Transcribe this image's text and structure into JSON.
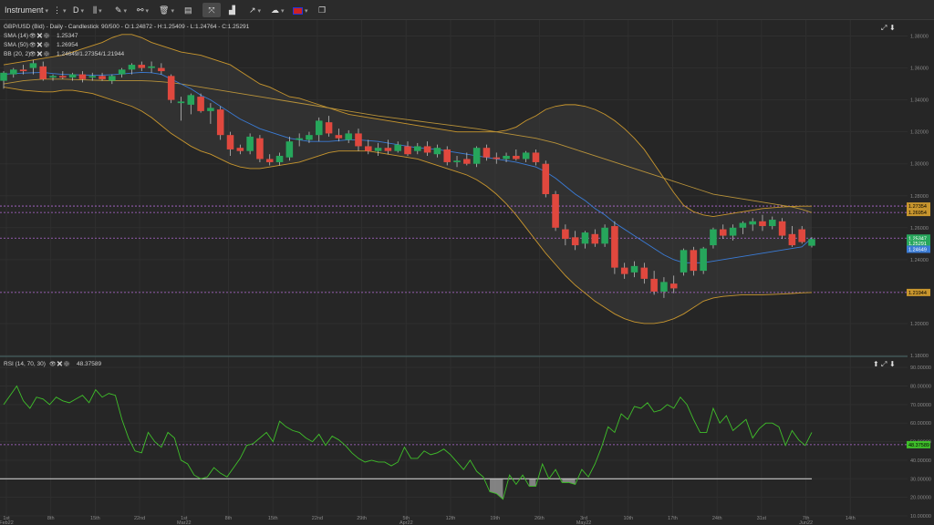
{
  "toolbar": {
    "instrument_label": "Instrument",
    "timeframe_label": "D",
    "language_flag": "gb-flag-icon"
  },
  "price_header": {
    "title": "GBP/USD (Bid) - Daily - Candlestick",
    "ohlc": "90/500 - O:1.24872 - H:1.25409 - L:1.24764 - C:1.25291",
    "sma14_label": "SMA (14)",
    "sma14_value": "1.25347",
    "sma50_label": "SMA (50)",
    "sma50_value": "1.26954",
    "bb_label": "BB (20, 2)",
    "bb_value": "1.24649/1.27354/1.21944"
  },
  "rsi_header": {
    "label": "RSI (14, 70, 30)",
    "value": "48.37589"
  },
  "price_axis": [
    "1.38000",
    "1.36000",
    "1.34000",
    "1.32000",
    "1.30000",
    "1.28000",
    "1.26000",
    "1.24000",
    "1.22000",
    "1.20000",
    "1.18000"
  ],
  "price_tags": {
    "bb_upper": "1.27354",
    "sma50": "1.26954",
    "sma14": "1.25347",
    "close": "1.25291",
    "bb_mid": "1.24649",
    "bb_lower": "1.21944"
  },
  "rsi_axis": [
    "90.00000",
    "80.00000",
    "70.00000",
    "60.00000",
    "50.00000",
    "40.00000",
    "30.00000",
    "20.00000",
    "10.00000"
  ],
  "rsi_tag": "48.37589",
  "date_axis": [
    {
      "label": "1st",
      "sub": "Feb22"
    },
    {
      "label": "8th",
      "sub": ""
    },
    {
      "label": "15th",
      "sub": ""
    },
    {
      "label": "22nd",
      "sub": ""
    },
    {
      "label": "1st",
      "sub": "Mar22"
    },
    {
      "label": "8th",
      "sub": ""
    },
    {
      "label": "15th",
      "sub": ""
    },
    {
      "label": "22nd",
      "sub": ""
    },
    {
      "label": "29th",
      "sub": ""
    },
    {
      "label": "5th",
      "sub": "Apr22"
    },
    {
      "label": "12th",
      "sub": ""
    },
    {
      "label": "19th",
      "sub": ""
    },
    {
      "label": "26th",
      "sub": ""
    },
    {
      "label": "3rd",
      "sub": "May22"
    },
    {
      "label": "10th",
      "sub": ""
    },
    {
      "label": "17th",
      "sub": ""
    },
    {
      "label": "24th",
      "sub": ""
    },
    {
      "label": "31st",
      "sub": ""
    },
    {
      "label": "7th",
      "sub": "Jun22"
    },
    {
      "label": "14th",
      "sub": ""
    }
  ],
  "colors": {
    "bull": "#26a65b",
    "bear": "#e0483e",
    "sma14": "#3a7bd5",
    "sma50": "#b8923a",
    "bb": "#c8962e",
    "rsi": "#3fbf2a",
    "hline": "#b36ad6"
  },
  "chart_data": {
    "type": "candlestick",
    "symbol": "GBP/USD (Bid)",
    "price_range": [
      1.18,
      1.39
    ],
    "candles": [
      {
        "o": 1.352,
        "h": 1.358,
        "l": 1.347,
        "c": 1.357
      },
      {
        "o": 1.356,
        "h": 1.36,
        "l": 1.354,
        "c": 1.359
      },
      {
        "o": 1.359,
        "h": 1.362,
        "l": 1.356,
        "c": 1.358
      },
      {
        "o": 1.36,
        "h": 1.365,
        "l": 1.356,
        "c": 1.363
      },
      {
        "o": 1.361,
        "h": 1.364,
        "l": 1.352,
        "c": 1.353
      },
      {
        "o": 1.354,
        "h": 1.356,
        "l": 1.352,
        "c": 1.355
      },
      {
        "o": 1.355,
        "h": 1.358,
        "l": 1.353,
        "c": 1.354
      },
      {
        "o": 1.354,
        "h": 1.357,
        "l": 1.352,
        "c": 1.356
      },
      {
        "o": 1.356,
        "h": 1.358,
        "l": 1.351,
        "c": 1.353
      },
      {
        "o": 1.354,
        "h": 1.357,
        "l": 1.352,
        "c": 1.355
      },
      {
        "o": 1.355,
        "h": 1.357,
        "l": 1.352,
        "c": 1.353
      },
      {
        "o": 1.352,
        "h": 1.356,
        "l": 1.35,
        "c": 1.355
      },
      {
        "o": 1.356,
        "h": 1.36,
        "l": 1.354,
        "c": 1.359
      },
      {
        "o": 1.359,
        "h": 1.363,
        "l": 1.356,
        "c": 1.362
      },
      {
        "o": 1.362,
        "h": 1.364,
        "l": 1.358,
        "c": 1.36
      },
      {
        "o": 1.36,
        "h": 1.364,
        "l": 1.357,
        "c": 1.361
      },
      {
        "o": 1.36,
        "h": 1.363,
        "l": 1.356,
        "c": 1.358
      },
      {
        "o": 1.355,
        "h": 1.356,
        "l": 1.338,
        "c": 1.34
      },
      {
        "o": 1.338,
        "h": 1.342,
        "l": 1.327,
        "c": 1.339
      },
      {
        "o": 1.337,
        "h": 1.344,
        "l": 1.331,
        "c": 1.343
      },
      {
        "o": 1.342,
        "h": 1.344,
        "l": 1.332,
        "c": 1.333
      },
      {
        "o": 1.333,
        "h": 1.338,
        "l": 1.325,
        "c": 1.335
      },
      {
        "o": 1.334,
        "h": 1.336,
        "l": 1.315,
        "c": 1.318
      },
      {
        "o": 1.318,
        "h": 1.32,
        "l": 1.305,
        "c": 1.309
      },
      {
        "o": 1.31,
        "h": 1.312,
        "l": 1.306,
        "c": 1.308
      },
      {
        "o": 1.308,
        "h": 1.319,
        "l": 1.306,
        "c": 1.317
      },
      {
        "o": 1.316,
        "h": 1.318,
        "l": 1.301,
        "c": 1.303
      },
      {
        "o": 1.303,
        "h": 1.306,
        "l": 1.299,
        "c": 1.301
      },
      {
        "o": 1.301,
        "h": 1.307,
        "l": 1.299,
        "c": 1.305
      },
      {
        "o": 1.304,
        "h": 1.317,
        "l": 1.302,
        "c": 1.314
      },
      {
        "o": 1.315,
        "h": 1.319,
        "l": 1.311,
        "c": 1.316
      },
      {
        "o": 1.315,
        "h": 1.32,
        "l": 1.313,
        "c": 1.318
      },
      {
        "o": 1.318,
        "h": 1.329,
        "l": 1.314,
        "c": 1.327
      },
      {
        "o": 1.326,
        "h": 1.33,
        "l": 1.317,
        "c": 1.319
      },
      {
        "o": 1.318,
        "h": 1.322,
        "l": 1.314,
        "c": 1.316
      },
      {
        "o": 1.315,
        "h": 1.321,
        "l": 1.313,
        "c": 1.319
      },
      {
        "o": 1.319,
        "h": 1.322,
        "l": 1.308,
        "c": 1.311
      },
      {
        "o": 1.311,
        "h": 1.315,
        "l": 1.306,
        "c": 1.308
      },
      {
        "o": 1.308,
        "h": 1.313,
        "l": 1.305,
        "c": 1.31
      },
      {
        "o": 1.31,
        "h": 1.315,
        "l": 1.306,
        "c": 1.308
      },
      {
        "o": 1.308,
        "h": 1.314,
        "l": 1.307,
        "c": 1.312
      },
      {
        "o": 1.311,
        "h": 1.314,
        "l": 1.305,
        "c": 1.306
      },
      {
        "o": 1.308,
        "h": 1.313,
        "l": 1.306,
        "c": 1.311
      },
      {
        "o": 1.311,
        "h": 1.314,
        "l": 1.305,
        "c": 1.307
      },
      {
        "o": 1.306,
        "h": 1.312,
        "l": 1.304,
        "c": 1.31
      },
      {
        "o": 1.309,
        "h": 1.311,
        "l": 1.299,
        "c": 1.301
      },
      {
        "o": 1.301,
        "h": 1.305,
        "l": 1.298,
        "c": 1.302
      },
      {
        "o": 1.303,
        "h": 1.307,
        "l": 1.299,
        "c": 1.3
      },
      {
        "o": 1.3,
        "h": 1.311,
        "l": 1.298,
        "c": 1.31
      },
      {
        "o": 1.31,
        "h": 1.312,
        "l": 1.302,
        "c": 1.304
      },
      {
        "o": 1.304,
        "h": 1.307,
        "l": 1.3,
        "c": 1.303
      },
      {
        "o": 1.303,
        "h": 1.307,
        "l": 1.301,
        "c": 1.305
      },
      {
        "o": 1.305,
        "h": 1.309,
        "l": 1.302,
        "c": 1.303
      },
      {
        "o": 1.303,
        "h": 1.308,
        "l": 1.301,
        "c": 1.307
      },
      {
        "o": 1.307,
        "h": 1.309,
        "l": 1.299,
        "c": 1.301
      },
      {
        "o": 1.3,
        "h": 1.302,
        "l": 1.279,
        "c": 1.281
      },
      {
        "o": 1.281,
        "h": 1.283,
        "l": 1.258,
        "c": 1.26
      },
      {
        "o": 1.259,
        "h": 1.262,
        "l": 1.249,
        "c": 1.253
      },
      {
        "o": 1.254,
        "h": 1.258,
        "l": 1.246,
        "c": 1.249
      },
      {
        "o": 1.25,
        "h": 1.258,
        "l": 1.247,
        "c": 1.257
      },
      {
        "o": 1.256,
        "h": 1.259,
        "l": 1.248,
        "c": 1.25
      },
      {
        "o": 1.25,
        "h": 1.262,
        "l": 1.248,
        "c": 1.26
      },
      {
        "o": 1.261,
        "h": 1.264,
        "l": 1.231,
        "c": 1.235
      },
      {
        "o": 1.235,
        "h": 1.238,
        "l": 1.228,
        "c": 1.231
      },
      {
        "o": 1.232,
        "h": 1.239,
        "l": 1.229,
        "c": 1.236
      },
      {
        "o": 1.235,
        "h": 1.238,
        "l": 1.225,
        "c": 1.228
      },
      {
        "o": 1.228,
        "h": 1.233,
        "l": 1.218,
        "c": 1.22
      },
      {
        "o": 1.22,
        "h": 1.229,
        "l": 1.216,
        "c": 1.226
      },
      {
        "o": 1.225,
        "h": 1.23,
        "l": 1.219,
        "c": 1.222
      },
      {
        "o": 1.232,
        "h": 1.247,
        "l": 1.23,
        "c": 1.246
      },
      {
        "o": 1.246,
        "h": 1.248,
        "l": 1.23,
        "c": 1.233
      },
      {
        "o": 1.233,
        "h": 1.248,
        "l": 1.231,
        "c": 1.247
      },
      {
        "o": 1.249,
        "h": 1.26,
        "l": 1.247,
        "c": 1.259
      },
      {
        "o": 1.259,
        "h": 1.262,
        "l": 1.253,
        "c": 1.255
      },
      {
        "o": 1.255,
        "h": 1.262,
        "l": 1.252,
        "c": 1.26
      },
      {
        "o": 1.26,
        "h": 1.264,
        "l": 1.256,
        "c": 1.263
      },
      {
        "o": 1.262,
        "h": 1.266,
        "l": 1.258,
        "c": 1.264
      },
      {
        "o": 1.264,
        "h": 1.268,
        "l": 1.258,
        "c": 1.261
      },
      {
        "o": 1.261,
        "h": 1.267,
        "l": 1.259,
        "c": 1.265
      },
      {
        "o": 1.264,
        "h": 1.266,
        "l": 1.253,
        "c": 1.255
      },
      {
        "o": 1.256,
        "h": 1.261,
        "l": 1.248,
        "c": 1.249
      },
      {
        "o": 1.259,
        "h": 1.261,
        "l": 1.25,
        "c": 1.251
      },
      {
        "o": 1.2487,
        "h": 1.2541,
        "l": 1.2476,
        "c": 1.2529
      }
    ],
    "sma14": [
      1.356,
      1.3565,
      1.3568,
      1.357,
      1.3572,
      1.3565,
      1.356,
      1.3558,
      1.3556,
      1.3555,
      1.3555,
      1.3558,
      1.3562,
      1.3568,
      1.3572,
      1.357,
      1.356,
      1.353,
      1.35,
      1.347,
      1.343,
      1.34,
      1.336,
      1.332,
      1.328,
      1.325,
      1.322,
      1.32,
      1.318,
      1.316,
      1.315,
      1.314,
      1.314,
      1.314,
      1.3145,
      1.315,
      1.315,
      1.3145,
      1.314,
      1.313,
      1.312,
      1.311,
      1.31,
      1.3095,
      1.309,
      1.308,
      1.307,
      1.306,
      1.305,
      1.304,
      1.303,
      1.302,
      1.301,
      1.2995,
      1.298,
      1.295,
      1.291,
      1.286,
      1.281,
      1.277,
      1.272,
      1.268,
      1.263,
      1.259,
      1.255,
      1.251,
      1.247,
      1.243,
      1.24,
      1.238,
      1.238,
      1.238,
      1.239,
      1.24,
      1.241,
      1.242,
      1.243,
      1.244,
      1.245,
      1.246,
      1.247,
      1.248,
      1.2535
    ],
    "sma50": [
      1.35,
      1.351,
      1.352,
      1.3525,
      1.353,
      1.353,
      1.353,
      1.3528,
      1.3526,
      1.3524,
      1.3522,
      1.352,
      1.352,
      1.352,
      1.352,
      1.3518,
      1.3514,
      1.3508,
      1.35,
      1.349,
      1.348,
      1.347,
      1.346,
      1.345,
      1.344,
      1.343,
      1.342,
      1.341,
      1.34,
      1.339,
      1.338,
      1.337,
      1.336,
      1.335,
      1.334,
      1.333,
      1.332,
      1.331,
      1.33,
      1.3292,
      1.3284,
      1.3276,
      1.3268,
      1.326,
      1.3252,
      1.3244,
      1.3236,
      1.3228,
      1.322,
      1.321,
      1.32,
      1.319,
      1.318,
      1.317,
      1.316,
      1.3145,
      1.313,
      1.311,
      1.309,
      1.307,
      1.305,
      1.303,
      1.301,
      1.299,
      1.297,
      1.295,
      1.293,
      1.291,
      1.289,
      1.287,
      1.285,
      1.283,
      1.281,
      1.28,
      1.279,
      1.278,
      1.277,
      1.276,
      1.275,
      1.274,
      1.273,
      1.2715,
      1.2695
    ],
    "bb_upper": [
      1.362,
      1.363,
      1.364,
      1.365,
      1.366,
      1.367,
      1.368,
      1.37,
      1.372,
      1.374,
      1.376,
      1.379,
      1.381,
      1.381,
      1.379,
      1.376,
      1.374,
      1.372,
      1.37,
      1.369,
      1.368,
      1.366,
      1.364,
      1.362,
      1.358,
      1.354,
      1.35,
      1.348,
      1.345,
      1.342,
      1.341,
      1.339,
      1.337,
      1.335,
      1.333,
      1.331,
      1.33,
      1.329,
      1.328,
      1.327,
      1.326,
      1.325,
      1.324,
      1.323,
      1.322,
      1.321,
      1.32,
      1.32,
      1.32,
      1.32,
      1.32,
      1.321,
      1.323,
      1.327,
      1.33,
      1.334,
      1.336,
      1.337,
      1.337,
      1.336,
      1.334,
      1.331,
      1.327,
      1.322,
      1.316,
      1.309,
      1.3,
      1.291,
      1.282,
      1.274,
      1.27,
      1.268,
      1.267,
      1.268,
      1.269,
      1.27,
      1.271,
      1.272,
      1.2725,
      1.273,
      1.2733,
      1.2735,
      1.2735
    ],
    "bb_lower": [
      1.348,
      1.347,
      1.346,
      1.3455,
      1.345,
      1.345,
      1.346,
      1.346,
      1.345,
      1.344,
      1.342,
      1.34,
      1.338,
      1.336,
      1.333,
      1.329,
      1.324,
      1.319,
      1.315,
      1.311,
      1.308,
      1.306,
      1.303,
      1.3,
      1.298,
      1.297,
      1.297,
      1.298,
      1.299,
      1.3,
      1.301,
      1.303,
      1.305,
      1.307,
      1.308,
      1.308,
      1.308,
      1.308,
      1.307,
      1.306,
      1.305,
      1.304,
      1.303,
      1.301,
      1.299,
      1.297,
      1.295,
      1.293,
      1.29,
      1.286,
      1.281,
      1.275,
      1.268,
      1.26,
      1.252,
      1.244,
      1.237,
      1.23,
      1.224,
      1.219,
      1.214,
      1.21,
      1.206,
      1.203,
      1.201,
      1.2,
      1.2,
      1.201,
      1.203,
      1.206,
      1.21,
      1.214,
      1.216,
      1.217,
      1.2175,
      1.218,
      1.218,
      1.218,
      1.2182,
      1.2185,
      1.2188,
      1.2192,
      1.2194
    ],
    "rsi_range": [
      10,
      95
    ],
    "rsi": [
      70,
      75,
      80,
      72,
      68,
      74,
      73,
      70,
      74,
      72,
      71,
      73,
      75,
      71,
      78,
      74,
      76,
      75,
      62,
      52,
      45,
      44,
      55,
      50,
      47,
      55,
      52,
      40,
      38,
      32,
      30,
      31,
      36,
      33,
      31,
      36,
      41,
      48,
      49,
      52,
      55,
      50,
      61,
      58,
      56,
      55,
      52,
      50,
      54,
      48,
      53,
      51,
      48,
      44,
      41,
      39,
      40,
      39,
      39,
      37,
      39,
      47,
      41,
      41,
      45,
      43,
      44,
      46,
      43,
      39,
      35,
      40,
      34,
      31,
      23,
      22,
      19,
      32,
      27,
      32,
      26,
      26,
      38,
      30,
      35,
      28,
      28,
      27,
      35,
      31,
      38,
      47,
      58,
      55,
      65,
      62,
      69,
      68,
      71,
      66,
      67,
      70,
      68,
      74,
      70,
      62,
      55,
      55,
      68,
      60,
      64,
      56,
      59,
      62,
      52,
      57,
      60,
      60,
      58,
      48,
      56,
      51,
      48,
      55
    ],
    "rsi_oversold": 30,
    "reference_lines": [
      1.27354,
      1.26954,
      1.25347,
      1.24649,
      1.21944
    ]
  }
}
